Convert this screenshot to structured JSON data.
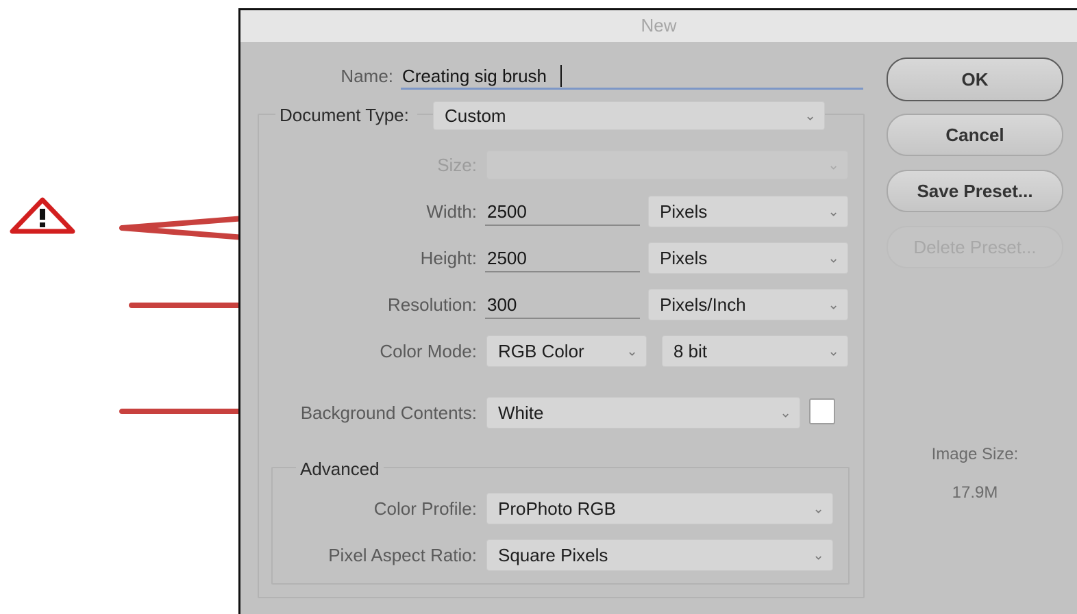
{
  "dialog": {
    "title": "New",
    "name_label": "Name:",
    "name_value": "Creating sig brush",
    "document_type": {
      "label": "Document Type:",
      "value": "Custom"
    },
    "size": {
      "label": "Size:",
      "value": ""
    },
    "width": {
      "label": "Width:",
      "value": "2500",
      "unit": "Pixels"
    },
    "height": {
      "label": "Height:",
      "value": "2500",
      "unit": "Pixels"
    },
    "resolution": {
      "label": "Resolution:",
      "value": "300",
      "unit": "Pixels/Inch"
    },
    "color_mode": {
      "label": "Color Mode:",
      "value": "RGB Color",
      "depth": "8 bit"
    },
    "background": {
      "label": "Background Contents:",
      "value": "White",
      "swatch_color": "#ffffff"
    },
    "advanced": {
      "title": "Advanced",
      "color_profile": {
        "label": "Color Profile:",
        "value": "ProPhoto RGB"
      },
      "pixel_aspect": {
        "label": "Pixel Aspect Ratio:",
        "value": "Square Pixels"
      }
    },
    "buttons": {
      "ok": "OK",
      "cancel": "Cancel",
      "save_preset": "Save Preset...",
      "delete_preset": "Delete Preset..."
    },
    "image_size": {
      "label": "Image Size:",
      "value": "17.9M"
    }
  },
  "annotations": {
    "warning_icon": "warning-triangle-icon",
    "arrow_color": "#c8413e"
  }
}
